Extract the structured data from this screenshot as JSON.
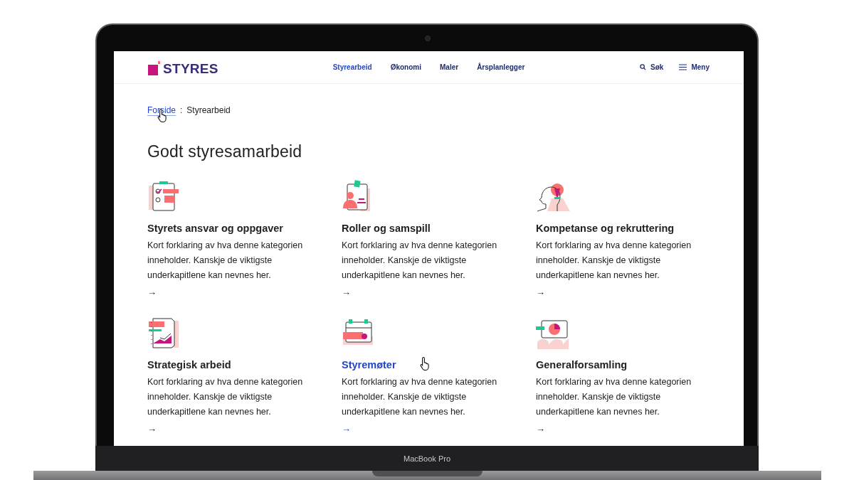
{
  "logo": {
    "text": "STYRES"
  },
  "nav": [
    {
      "label": "Styrearbeid",
      "selected": true
    },
    {
      "label": "Økonomi",
      "selected": false
    },
    {
      "label": "Maler",
      "selected": false
    },
    {
      "label": "Årsplanlegger",
      "selected": false
    }
  ],
  "search": {
    "label": "Søk"
  },
  "menu": {
    "label": "Meny"
  },
  "breadcrumb": {
    "separator": ":",
    "items": [
      {
        "label": "Forside",
        "hovered": true
      },
      {
        "label": "Styrearbeid",
        "hovered": false
      }
    ]
  },
  "heading": "Godt styresamarbeid",
  "cards": [
    {
      "title": "Styrets ansvar og oppgaver",
      "description": "Kort forklaring av hva denne kategorien inneholder. Kanskje de viktigste underkapitlene kan nevnes her.",
      "arrow": "→",
      "hovered": false
    },
    {
      "title": "Roller og samspill",
      "description": "Kort forklaring av hva denne kategorien inneholder. Kanskje de viktigste underkapitlene kan nevnes her.",
      "arrow": "→",
      "hovered": false
    },
    {
      "title": "Kompetanse og rekruttering",
      "description": "Kort forklaring av hva denne kategorien inneholder. Kanskje de viktigste underkapitlene kan nevnes her.",
      "arrow": "→",
      "hovered": false
    },
    {
      "title": "Strategisk arbeid",
      "description": "Kort forklaring av hva denne kategorien inneholder. Kanskje de viktigste underkapitlene kan nevnes her.",
      "arrow": "→",
      "hovered": false
    },
    {
      "title": "Styremøter",
      "description": "Kort forklaring av hva denne kategorien inneholder. Kanskje de viktigste underkapitlene kan nevnes her.",
      "arrow": "→",
      "hovered": true
    },
    {
      "title": "Generalforsamling",
      "description": "Kort forklaring av hva denne kategorien inneholder. Kanskje de viktigste underkapitlene kan nevnes her.",
      "arrow": "→",
      "hovered": false
    }
  ],
  "device_label": "MacBook Pro"
}
